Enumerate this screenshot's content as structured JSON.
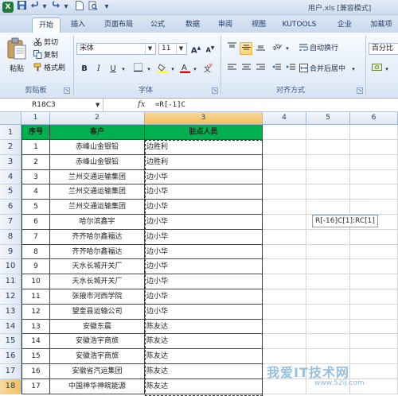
{
  "window": {
    "title": "用户.xls  [兼容模式]",
    "app_logo": "X",
    "qat": [
      "save-icon",
      "undo-icon",
      "redo-icon",
      "new-file-icon",
      "print-preview-icon"
    ]
  },
  "tabs": [
    {
      "label": "开始",
      "active": true
    },
    {
      "label": "插入"
    },
    {
      "label": "页面布局"
    },
    {
      "label": "公式"
    },
    {
      "label": "数据"
    },
    {
      "label": "审阅"
    },
    {
      "label": "视图"
    },
    {
      "label": "KUTOOLS"
    },
    {
      "label": "企业"
    },
    {
      "label": "加载项"
    }
  ],
  "ribbon": {
    "clipboard": {
      "paste": "粘贴",
      "cut": "剪切",
      "copy": "复制",
      "format_painter": "格式刷",
      "label": "剪贴板"
    },
    "font": {
      "name": "宋体",
      "size": "11",
      "grow": "A",
      "shrink": "A",
      "bold": "B",
      "italic": "I",
      "underline": "U",
      "label": "字体",
      "font_color": "#ff0000",
      "fill_color": "#ffff00"
    },
    "alignment": {
      "wrap": "自动换行",
      "merge": "合并后居中",
      "label": "对齐方式"
    },
    "number": {
      "format": "百分比"
    }
  },
  "formula_bar": {
    "name_box": "R18C3",
    "fx": "fx",
    "formula": "=R[-1]C"
  },
  "grid": {
    "columns": [
      "1",
      "2",
      "3",
      "4",
      "5",
      "6"
    ],
    "header_row": {
      "seq": "序号",
      "customer": "客户",
      "staff": "驻点人员"
    },
    "rows": [
      {
        "row": "2",
        "seq": "1",
        "customer": "赤峰山金银铅",
        "staff": "边胜利"
      },
      {
        "row": "3",
        "seq": "2",
        "customer": "赤峰山金银铅",
        "staff": "边胜利"
      },
      {
        "row": "4",
        "seq": "3",
        "customer": "兰州交通运输集团",
        "staff": "边小华"
      },
      {
        "row": "5",
        "seq": "4",
        "customer": "兰州交通运输集团",
        "staff": "边小华"
      },
      {
        "row": "6",
        "seq": "5",
        "customer": "兰州交通运输集团",
        "staff": "边小华"
      },
      {
        "row": "7",
        "seq": "6",
        "customer": "哈尔滨鑫宇",
        "staff": "边小华"
      },
      {
        "row": "8",
        "seq": "7",
        "customer": "齐齐哈尔鑫福达",
        "staff": "边小华"
      },
      {
        "row": "9",
        "seq": "8",
        "customer": "齐齐哈尔鑫福达",
        "staff": "边小华"
      },
      {
        "row": "10",
        "seq": "9",
        "customer": "天水长城开关厂",
        "staff": "边小华"
      },
      {
        "row": "11",
        "seq": "10",
        "customer": "天水长城开关厂",
        "staff": "边小华"
      },
      {
        "row": "12",
        "seq": "11",
        "customer": "张掖市河西学院",
        "staff": "边小华"
      },
      {
        "row": "13",
        "seq": "12",
        "customer": "望奎县运输公司",
        "staff": "边小华"
      },
      {
        "row": "14",
        "seq": "13",
        "customer": "安徽东晨",
        "staff": "陈友达"
      },
      {
        "row": "15",
        "seq": "14",
        "customer": "安徽浩宇商旅",
        "staff": "陈友达"
      },
      {
        "row": "16",
        "seq": "15",
        "customer": "安徽浩宇商旅",
        "staff": "陈友达"
      },
      {
        "row": "17",
        "seq": "16",
        "customer": "安徽省汽运集团",
        "staff": "陈友达"
      },
      {
        "row": "18",
        "seq": "17",
        "customer": "中国神华神皖能源",
        "staff": "陈友达"
      }
    ],
    "header_color": "#00b050",
    "tooltip": "R[-16]C[1]:RC[1]"
  },
  "watermark": {
    "text": "我爱IT技术网",
    "url": "www.52ij.com"
  }
}
